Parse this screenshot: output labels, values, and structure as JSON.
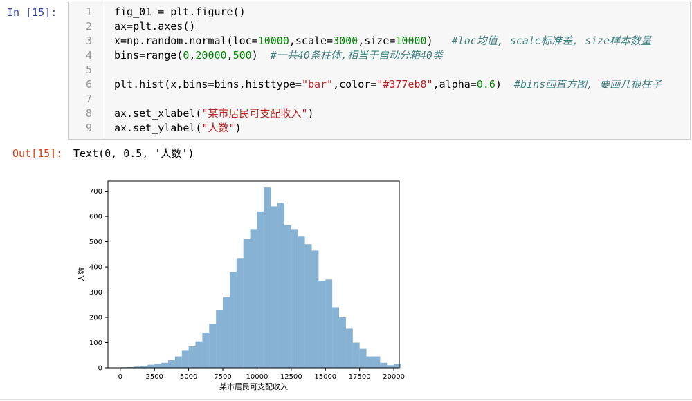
{
  "input_prompt": "In  [15]:",
  "output_prompt": "Out[15]:",
  "output_text": "Text(0, 0.5, '人数')",
  "code_lines": [
    {
      "n": "1",
      "tokens": [
        {
          "t": "fig_01 = plt.figure()",
          "c": ""
        }
      ]
    },
    {
      "n": "2",
      "tokens": [
        {
          "t": "ax=plt.axes()",
          "c": ""
        }
      ],
      "cursor": true
    },
    {
      "n": "3",
      "tokens": [
        {
          "t": "x=np.random.normal(loc=",
          "c": ""
        },
        {
          "t": "10000",
          "c": "num"
        },
        {
          "t": ",scale=",
          "c": ""
        },
        {
          "t": "3000",
          "c": "num"
        },
        {
          "t": ",size=",
          "c": ""
        },
        {
          "t": "10000",
          "c": "num"
        },
        {
          "t": ")   ",
          "c": ""
        },
        {
          "t": "#loc均值, scale标准差, size样本数量",
          "c": "cmt"
        }
      ]
    },
    {
      "n": "4",
      "tokens": [
        {
          "t": "bins=range(",
          "c": ""
        },
        {
          "t": "0",
          "c": "num"
        },
        {
          "t": ",",
          "c": ""
        },
        {
          "t": "20000",
          "c": "num"
        },
        {
          "t": ",",
          "c": ""
        },
        {
          "t": "500",
          "c": "num"
        },
        {
          "t": ")  ",
          "c": ""
        },
        {
          "t": "#一共40条柱体,相当于自动分箱40类",
          "c": "cmt"
        }
      ]
    },
    {
      "n": "5",
      "tokens": [
        {
          "t": "",
          "c": ""
        }
      ]
    },
    {
      "n": "6",
      "tokens": [
        {
          "t": "plt.hist(x,bins=bins,histtype=",
          "c": ""
        },
        {
          "t": "\"bar\"",
          "c": "str"
        },
        {
          "t": ",color=",
          "c": ""
        },
        {
          "t": "\"#377eb8\"",
          "c": "str"
        },
        {
          "t": ",alpha=",
          "c": ""
        },
        {
          "t": "0.6",
          "c": "num"
        },
        {
          "t": ")  ",
          "c": ""
        },
        {
          "t": "#bins画直方图, 要画几根柱子",
          "c": "cmt"
        }
      ]
    },
    {
      "n": "7",
      "tokens": [
        {
          "t": "",
          "c": ""
        }
      ]
    },
    {
      "n": "8",
      "tokens": [
        {
          "t": "ax.set_xlabel(",
          "c": ""
        },
        {
          "t": "\"某市居民可支配收入\"",
          "c": "str"
        },
        {
          "t": ")",
          "c": ""
        }
      ]
    },
    {
      "n": "9",
      "tokens": [
        {
          "t": "ax.set_ylabel(",
          "c": ""
        },
        {
          "t": "\"人数\"",
          "c": "str"
        },
        {
          "t": ")",
          "c": ""
        }
      ]
    }
  ],
  "chart_data": {
    "type": "bar",
    "bin_start": 0,
    "bin_width": 500,
    "values": [
      2,
      3,
      5,
      8,
      12,
      15,
      20,
      30,
      45,
      70,
      85,
      105,
      140,
      175,
      230,
      280,
      380,
      435,
      510,
      550,
      620,
      715,
      640,
      655,
      565,
      550,
      520,
      490,
      465,
      345,
      350,
      240,
      200,
      155,
      100,
      75,
      45,
      45,
      20,
      10,
      15
    ],
    "color": "#377eb8",
    "alpha": 0.6,
    "xlabel": "某市居民可支配收入",
    "ylabel": "人数",
    "xlim": [
      -900,
      20400
    ],
    "ylim": [
      0,
      740
    ],
    "xticks": [
      0,
      2500,
      5000,
      7500,
      10000,
      12500,
      15000,
      17500,
      20000
    ],
    "yticks": [
      0,
      100,
      200,
      300,
      400,
      500,
      600,
      700
    ]
  }
}
